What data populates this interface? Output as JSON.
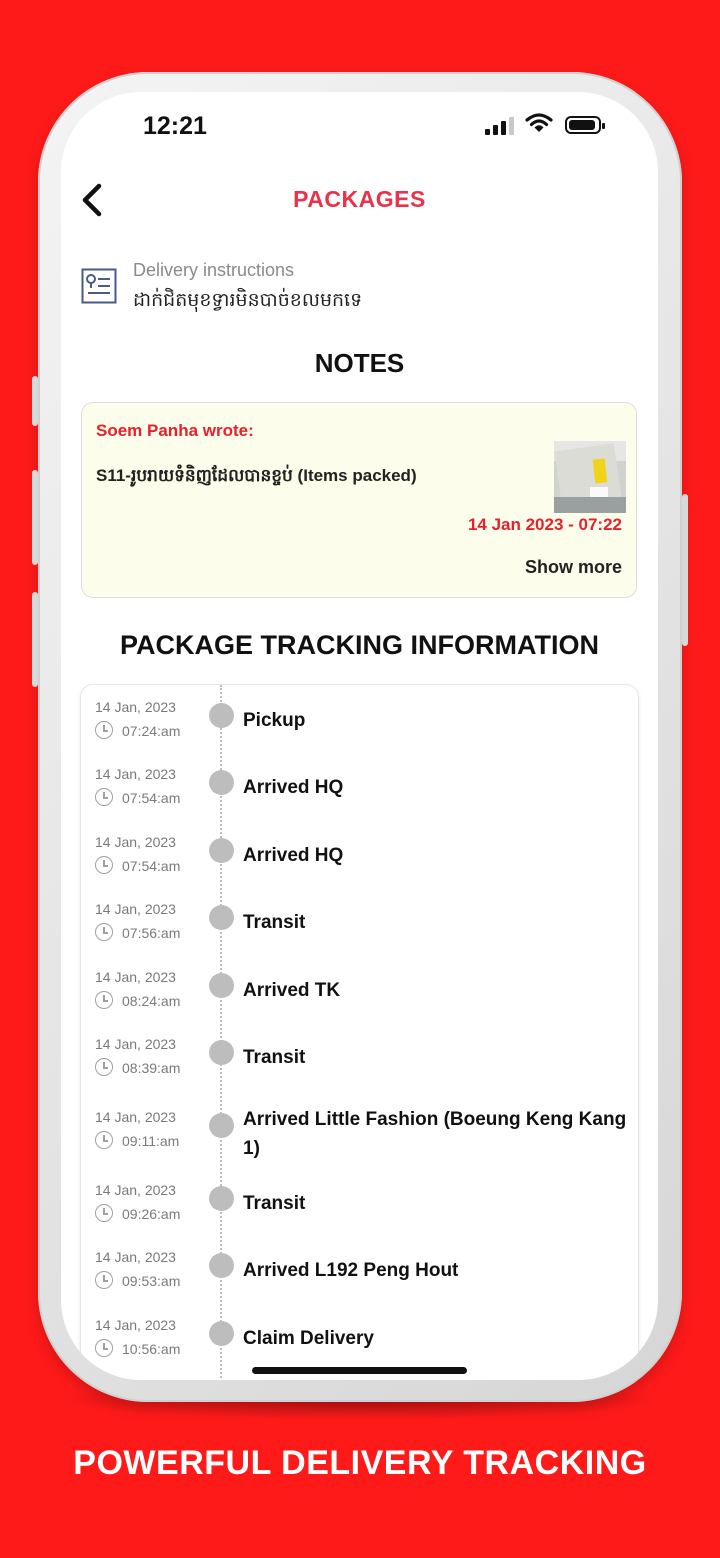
{
  "status_bar": {
    "time": "12:21"
  },
  "header": {
    "title": "PACKAGES",
    "back_icon": "chevron-left-icon"
  },
  "delivery": {
    "label": "Delivery instructions",
    "value": "ដាក់ជិតមុខទ្វារមិនបាច់ខលមកទេ",
    "icon": "instructions-icon"
  },
  "notes": {
    "title": "NOTES",
    "author": "Soem Panha wrote:",
    "text": "S11-រូបរាយទំនិញដែលបានខ្ចប់ (Items packed)",
    "datetime": "14 Jan 2023 - 07:22",
    "show_more": "Show more"
  },
  "tracking": {
    "title": "PACKAGE TRACKING INFORMATION",
    "rows": [
      {
        "date": "14 Jan, 2023",
        "time": "07:24:am",
        "status": "Pickup"
      },
      {
        "date": "14 Jan, 2023",
        "time": "07:54:am",
        "status": "Arrived HQ"
      },
      {
        "date": "14 Jan, 2023",
        "time": "07:54:am",
        "status": "Arrived HQ"
      },
      {
        "date": "14 Jan, 2023",
        "time": "07:56:am",
        "status": "Transit"
      },
      {
        "date": "14 Jan, 2023",
        "time": "08:24:am",
        "status": "Arrived TK"
      },
      {
        "date": "14 Jan, 2023",
        "time": "08:39:am",
        "status": "Transit"
      },
      {
        "date": "14 Jan, 2023",
        "time": "09:11:am",
        "status": "Arrived Little Fashion (Boeung Keng Kang 1)"
      },
      {
        "date": "14 Jan, 2023",
        "time": "09:26:am",
        "status": "Transit"
      },
      {
        "date": "14 Jan, 2023",
        "time": "09:53:am",
        "status": "Arrived L192 Peng Hout"
      },
      {
        "date": "14 Jan, 2023",
        "time": "10:56:am",
        "status": "Claim Delivery"
      }
    ]
  },
  "tagline": "POWERFUL DELIVERY TRACKING",
  "colors": {
    "background": "#ff1a1a",
    "accent": "#e8334b",
    "note_bg": "#fdfdec"
  }
}
